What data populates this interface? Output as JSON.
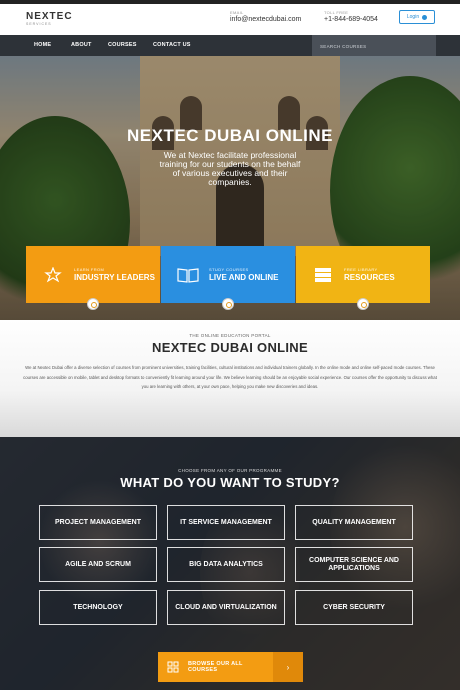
{
  "header": {
    "logo_main": "NEXTEC",
    "logo_sub": "SERVICES",
    "email_label": "EMAIL",
    "email_value": "info@nextecdubai.com",
    "phone_label": "TOLL FREE",
    "phone_value": "+1-844-689-4054",
    "login_label": "Login"
  },
  "nav": {
    "items": [
      "HOME",
      "ABOUT",
      "COURSES",
      "CONTACT US"
    ],
    "search_placeholder": "SEARCH COURSES"
  },
  "hero": {
    "title": "NEXTEC DUBAI ONLINE",
    "subtitle": "We at Nextec facilitate professional training for our students on the behalf of various executives and their companies."
  },
  "features": [
    {
      "small": "LEARN FROM",
      "big": "INDUSTRY LEADERS",
      "icon": "award-icon",
      "color": "#f39c12"
    },
    {
      "small": "STUDY COURSES",
      "big": "LIVE AND ONLINE",
      "icon": "book-icon",
      "color": "#2a8fe0"
    },
    {
      "small": "FREE LIBRARY",
      "big": "RESOURCES",
      "icon": "library-icon",
      "color": "#f1b414"
    }
  ],
  "about": {
    "kicker": "THE ONLINE EDUCATION PORTAL",
    "title": "NEXTEC DUBAI ONLINE",
    "body": "We at Nextec Dubai offer a diverse selection of courses from prominent universities, training facilities, cultural institutions and individual trainers globally. In the online mode and online self-paced mode courses. These courses are accessible on mobile, tablet and desktop formats to conveniently fit learning around your life. We believe learning should be an enjoyable social experience. Our courses offer the opportunity to discuss what you are learning with others, at your own pace, helping you make new discoveries and ideas."
  },
  "study": {
    "kicker": "CHOOSE FROM ANY OF OUR PROGRAMME",
    "title": "WHAT DO YOU WANT TO STUDY?",
    "courses": [
      "PROJECT MANAGEMENT",
      "IT SERVICE MANAGEMENT",
      "QUALITY MANAGEMENT",
      "AGILE AND SCRUM",
      "BIG DATA ANALYTICS",
      "COMPUTER SCIENCE AND APPLICATIONS",
      "TECHNOLOGY",
      "CLOUD AND VIRTUALIZATION",
      "CYBER SECURITY"
    ],
    "browse_label": "BROWSE OUR ALL COURSES",
    "browse_arrow": "›"
  },
  "colors": {
    "accent_orange": "#f39c12",
    "accent_blue": "#2a8fe0",
    "accent_yellow": "#f1b414",
    "nav_bg": "#2d3238"
  }
}
